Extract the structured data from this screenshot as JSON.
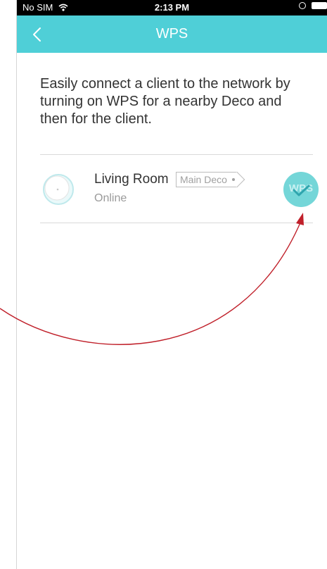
{
  "status_bar": {
    "carrier": "No SIM",
    "wifi_icon": "wifi-icon",
    "time": "2:13 PM",
    "orientation_lock_icon": "orientation-lock-icon",
    "battery_icon": "battery-icon"
  },
  "header": {
    "back_icon": "chevron-left-icon",
    "title": "WPS",
    "background_color": "#4fcfd7"
  },
  "main": {
    "description": "Easily connect a client to the network by turning on WPS for a nearby Deco and then for the client.",
    "devices": [
      {
        "name": "Living Room",
        "tag": "Main Deco",
        "status": "Online",
        "icon": "deco-device-icon",
        "wps_button_label": "WPS",
        "wps_check_icon": "checkmark-icon"
      }
    ]
  },
  "annotation": {
    "arrow_color": "#c0202a",
    "arrow_icon": "curved-arrow-icon"
  }
}
